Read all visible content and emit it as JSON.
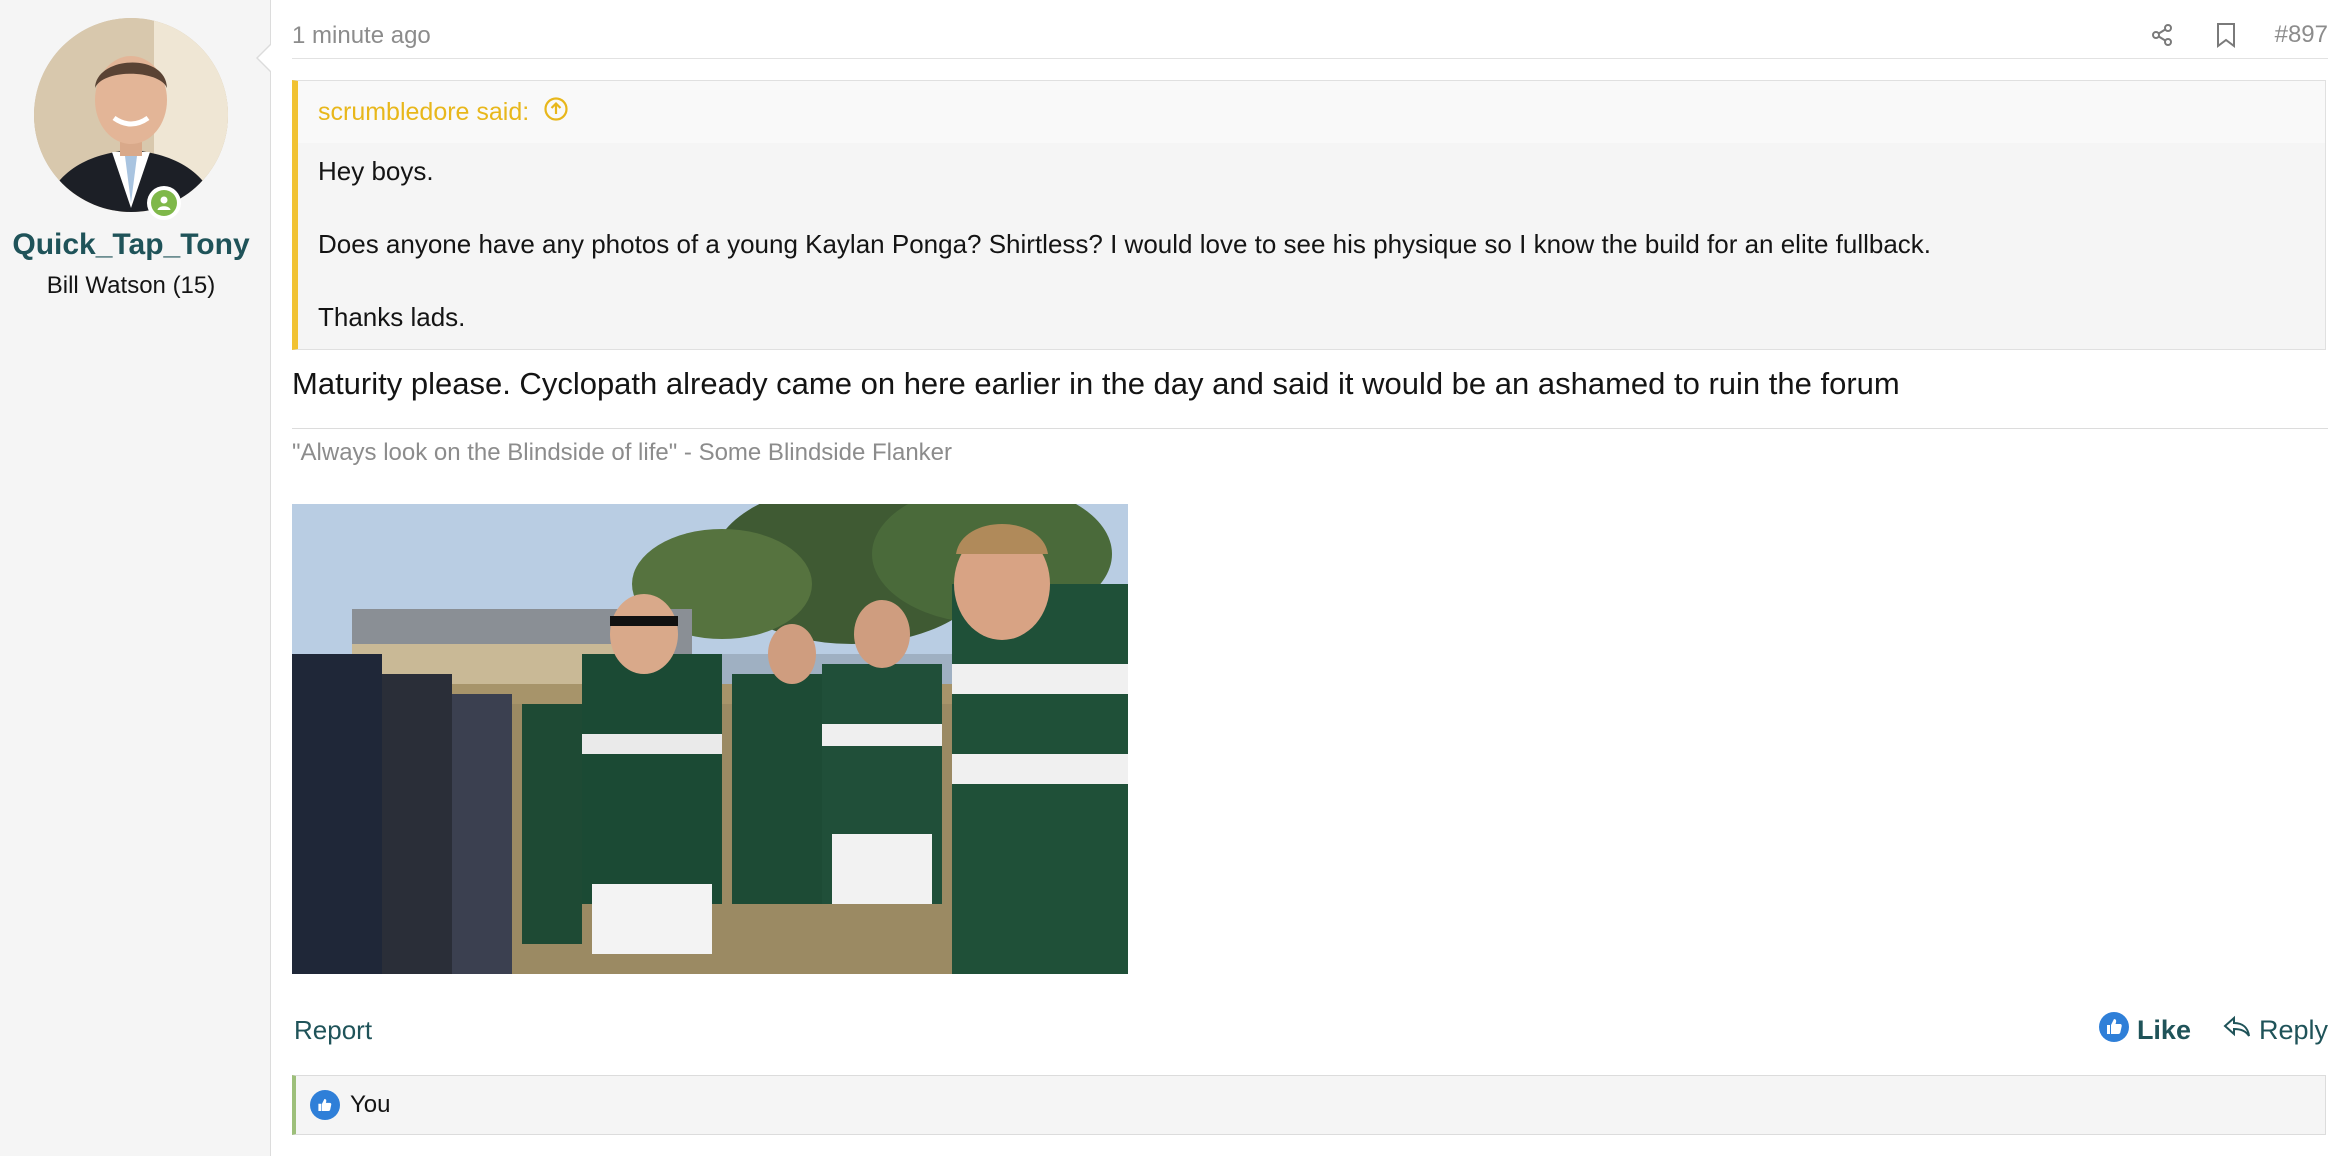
{
  "user": {
    "name": "Quick_Tap_Tony",
    "title": "Bill Watson (15)",
    "online_color": "#7fb84a"
  },
  "post": {
    "time": "1 minute ago",
    "number": "#897",
    "icons": [
      "share-icon",
      "bookmark-icon"
    ],
    "quote": {
      "author_label": "scrumbledore said:",
      "lines": [
        "Hey boys.",
        "Does anyone have any photos of a young Kaylan Ponga? Shirtless? I would love to see his physique so I know the build for an elite fullback.",
        "Thanks lads."
      ]
    },
    "text": "Maturity please. Cyclopath already came on here earlier in the day and said it would be an ashamed to ruin the forum",
    "signature": "\"Always look on the Blindside of life\" - Some Blindside Flanker",
    "image_alt": "rugby players walking through a guard of honour"
  },
  "actions": {
    "report": "Report",
    "like": "Like",
    "reply": "Reply"
  },
  "reactions": {
    "text": "You"
  },
  "colors": {
    "link": "#1f5359",
    "quote_accent": "#f1c232",
    "like_blue": "#2f7fd8"
  }
}
